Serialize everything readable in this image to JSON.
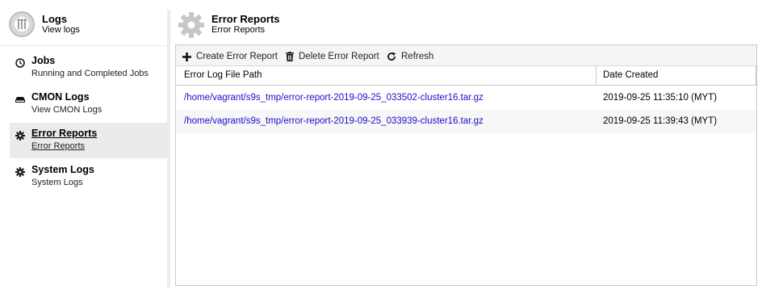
{
  "sidebar": {
    "title": "Logs",
    "subtitle": "View logs",
    "items": [
      {
        "label": "Jobs",
        "sub": "Running and Completed Jobs",
        "icon": "clock-icon"
      },
      {
        "label": "CMON Logs",
        "sub": "View CMON Logs",
        "icon": "drive-icon"
      },
      {
        "label": "Error Reports",
        "sub": "Error Reports",
        "icon": "gear-icon",
        "active": true
      },
      {
        "label": "System Logs",
        "sub": "System Logs",
        "icon": "gear-icon"
      }
    ]
  },
  "main": {
    "title": "Error Reports",
    "subtitle": "Error Reports",
    "toolbar": {
      "create_label": "Create Error Report",
      "delete_label": "Delete Error Report",
      "refresh_label": "Refresh"
    },
    "table": {
      "columns": [
        "Error Log File Path",
        "Date Created"
      ],
      "rows": [
        {
          "path": "/home/vagrant/s9s_tmp/error-report-2019-09-25_033502-cluster16.tar.gz",
          "date": "2019-09-25 11:35:10 (MYT)"
        },
        {
          "path": "/home/vagrant/s9s_tmp/error-report-2019-09-25_033939-cluster16.tar.gz",
          "date": "2019-09-25 11:39:43 (MYT)"
        }
      ]
    }
  },
  "colors": {
    "link": "#1a0dcc",
    "active_bg": "#ebebeb",
    "toolbar_bg": "#f5f5f5"
  }
}
